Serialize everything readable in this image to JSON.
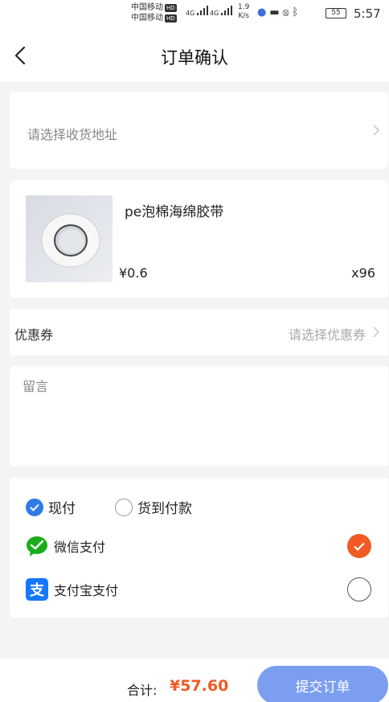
{
  "status_bar": {
    "carrier_1": "中国移动",
    "carrier_2": "中国移动",
    "hd": "HD",
    "net_1": "4G",
    "net_2": "4G",
    "speed_value": "1.9",
    "speed_unit": "K/s",
    "battery": "55",
    "time": "5:57"
  },
  "header": {
    "title": "订单确认"
  },
  "address": {
    "placeholder": "请选择收货地址"
  },
  "product": {
    "name": "pe泡棉海绵胶带",
    "price": "¥0.6",
    "quantity": "x96"
  },
  "coupon": {
    "label": "优惠券",
    "placeholder": "请选择优惠券"
  },
  "message": {
    "placeholder": "留言"
  },
  "payment": {
    "options": [
      {
        "label": "现付",
        "selected": true
      },
      {
        "label": "货到付款",
        "selected": false
      }
    ],
    "methods": [
      {
        "label": "微信支付",
        "icon": "wechat-pay-icon",
        "selected": true
      },
      {
        "label": "支付宝支付",
        "icon": "alipay-icon",
        "selected": false
      }
    ]
  },
  "footer": {
    "total_label": "合计:",
    "total_value": "¥57.60",
    "submit_label": "提交订单"
  },
  "colors": {
    "accent_blue": "#2f7ae5",
    "accent_orange": "#f15a24",
    "submit_button": "#7c9ef0"
  }
}
